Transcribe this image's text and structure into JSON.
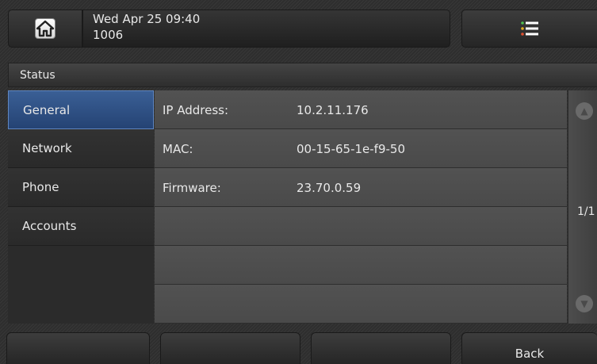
{
  "header": {
    "date_time": "Wed Apr 25 09:40",
    "extension": "1006",
    "home_icon": "home-icon",
    "menu_icon": "menu-list-icon"
  },
  "title": "Status",
  "sidebar": {
    "items": [
      {
        "label": "General",
        "active": true
      },
      {
        "label": "Network",
        "active": false
      },
      {
        "label": "Phone",
        "active": false
      },
      {
        "label": "Accounts",
        "active": false
      }
    ]
  },
  "status_rows": [
    {
      "label": "IP Address:",
      "value": "10.2.11.176"
    },
    {
      "label": "MAC:",
      "value": "00-15-65-1e-f9-50"
    },
    {
      "label": "Firmware:",
      "value": "23.70.0.59"
    },
    {
      "label": "",
      "value": ""
    },
    {
      "label": "",
      "value": ""
    },
    {
      "label": "",
      "value": ""
    }
  ],
  "pager": {
    "indicator": "1/1"
  },
  "softkeys": [
    "",
    "",
    "",
    "Back"
  ],
  "colors": {
    "accent": "#2f5289"
  }
}
